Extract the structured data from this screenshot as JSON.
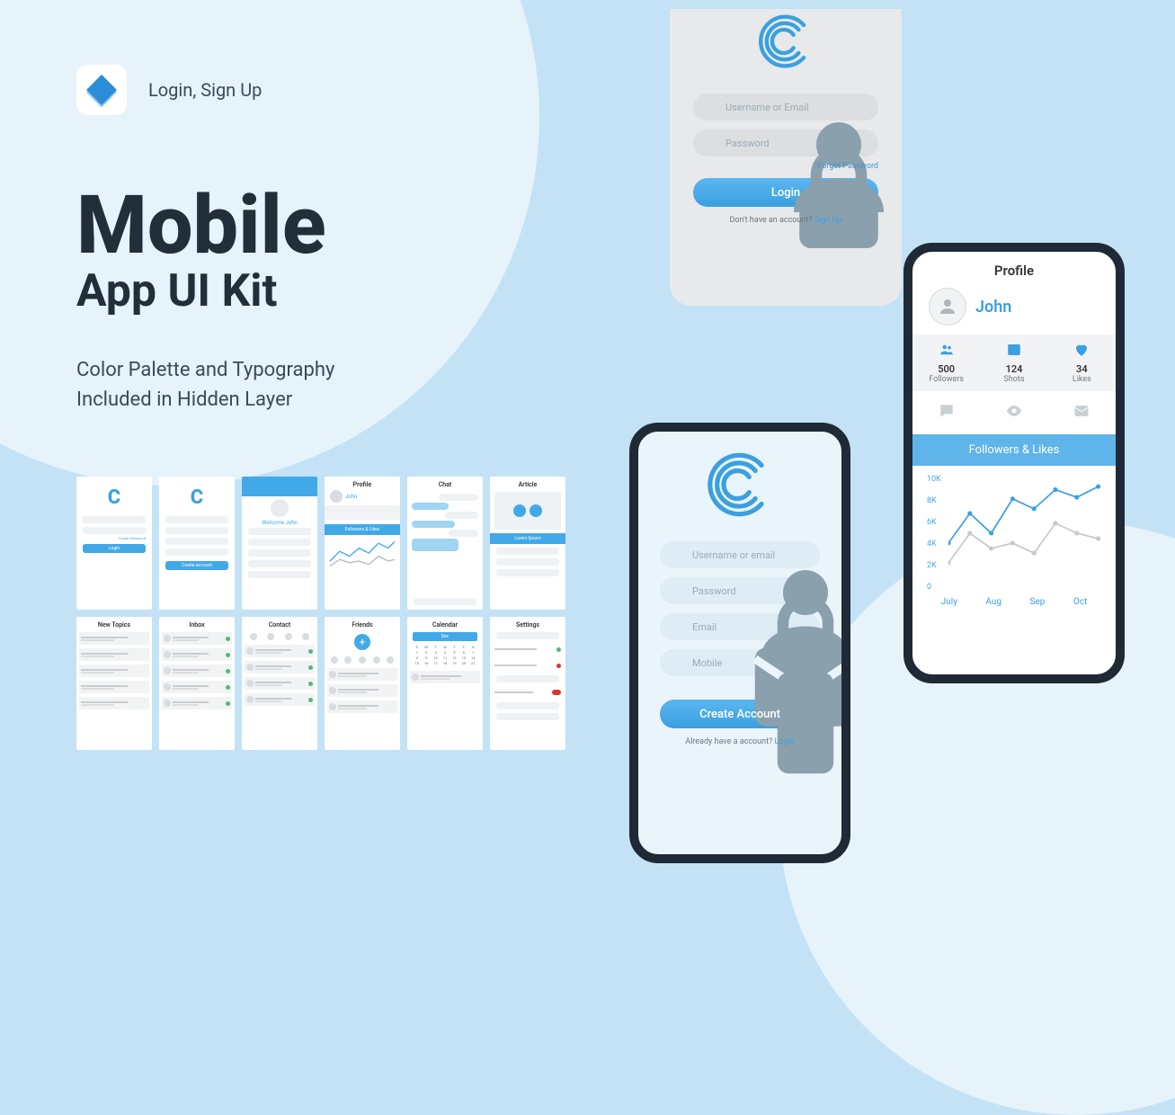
{
  "topLabel": "Login, Sign Up",
  "hero": {
    "line1": "Mobile",
    "line2": "App UI Kit"
  },
  "sub1": "Color Palette and Typography",
  "sub2": "Included in Hidden Layer",
  "thumbs": {
    "row1": [
      "",
      "",
      "",
      "Profile",
      "Chat",
      "Article"
    ],
    "row2": [
      "New Topics",
      "Inbox",
      "Contact",
      "Friends",
      "Calendar",
      "Settings"
    ],
    "loginBtn": "Login",
    "createBtn": "Create account",
    "welcome": "Welcome John",
    "profileName": "John",
    "calMonth": "Dec"
  },
  "login": {
    "userPh": "Username or Email",
    "passPh": "Password",
    "forgot": "Forget Password",
    "btn": "Login",
    "noacc": "Don't have an account? ",
    "signup": "Sign Up"
  },
  "signup": {
    "userPh": "Username or email",
    "passPh": "Password",
    "emailPh": "Email",
    "mobilePh": "Mobile",
    "btn": "Create Account",
    "already": "Already have a account? ",
    "loginLink": "Login"
  },
  "profile": {
    "title": "Profile",
    "name": "John",
    "followersNum": "500",
    "followersLab": "Followers",
    "shotsNum": "124",
    "shotsLab": "Shots",
    "likesNum": "34",
    "likesLab": "Likes",
    "band": "Followers & Likes",
    "yticks": [
      "10K",
      "8K",
      "6K",
      "4K",
      "2K",
      "0"
    ],
    "xticks": [
      "July",
      "Aug",
      "Sep",
      "Oct"
    ]
  },
  "chart_data": {
    "type": "line",
    "title": "Followers & Likes",
    "xlabel": "",
    "ylabel": "",
    "ylim": [
      0,
      10000
    ],
    "categories": [
      "July",
      "Aug",
      "Sep",
      "Oct"
    ],
    "series": [
      {
        "name": "Followers",
        "values_approx": [
          4000,
          7000,
          5000,
          8500,
          7500,
          9500,
          9000,
          9800
        ]
      },
      {
        "name": "Likes",
        "values_approx": [
          2000,
          5000,
          3500,
          4000,
          3000,
          6000,
          5000,
          4500
        ]
      }
    ]
  }
}
